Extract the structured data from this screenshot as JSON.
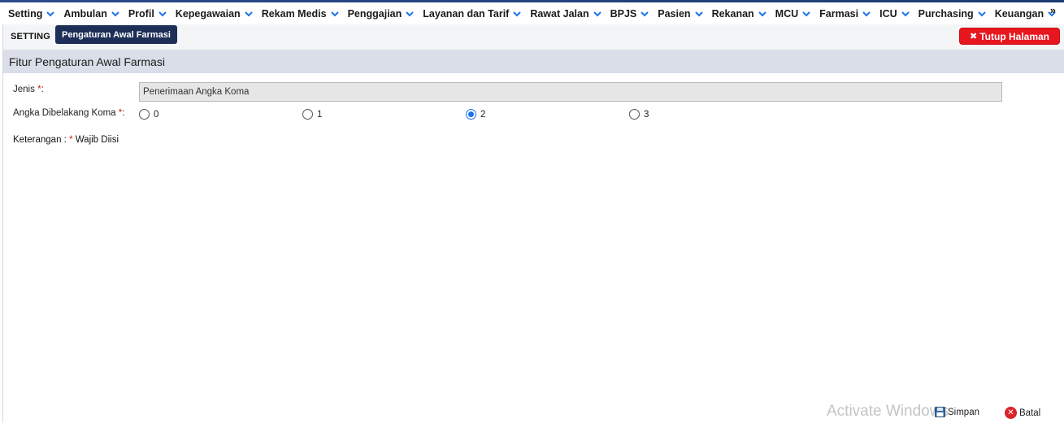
{
  "menu": {
    "items": [
      {
        "label": "Setting"
      },
      {
        "label": "Ambulan"
      },
      {
        "label": "Profil"
      },
      {
        "label": "Kepegawaian"
      },
      {
        "label": "Rekam Medis"
      },
      {
        "label": "Penggajian"
      },
      {
        "label": "Layanan dan Tarif"
      },
      {
        "label": "Rawat Jalan"
      },
      {
        "label": "BPJS"
      },
      {
        "label": "Pasien"
      },
      {
        "label": "Rekanan"
      },
      {
        "label": "MCU"
      },
      {
        "label": "Farmasi"
      },
      {
        "label": "ICU"
      },
      {
        "label": "Purchasing"
      },
      {
        "label": "Keuangan"
      }
    ],
    "more": "»",
    "accent_color": "#1a73e8"
  },
  "subbar": {
    "section": "SETTING",
    "active_tab": "Pengaturan Awal Farmasi",
    "close_label": "Tutup Halaman"
  },
  "form": {
    "title": "Fitur Pengaturan Awal Farmasi",
    "jenis_label": "Jenis",
    "jenis_value": "Penerimaan Angka Koma",
    "angka_label": "Angka Dibelakang Koma",
    "required_mark": "*",
    "label_suffix": ":",
    "options": [
      {
        "label": "0",
        "checked": false
      },
      {
        "label": "1",
        "checked": false
      },
      {
        "label": "2",
        "checked": true
      },
      {
        "label": "3",
        "checked": false
      }
    ],
    "keterangan_prefix": "Keterangan :",
    "keterangan_text": "Wajib Diisi"
  },
  "footer": {
    "watermark": "Activate Windows",
    "save_label": "Simpan",
    "cancel_label": "Batal"
  }
}
